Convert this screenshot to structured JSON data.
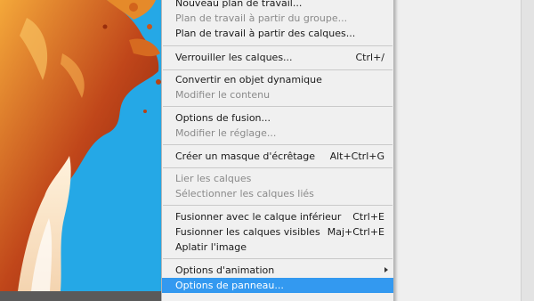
{
  "menu": {
    "items": [
      {
        "label": "Nouveau plan de travail...",
        "shortcut": "",
        "state": "enabled"
      },
      {
        "label": "Plan de travail à partir du groupe...",
        "shortcut": "",
        "state": "disabled"
      },
      {
        "label": "Plan de travail à partir des calques...",
        "shortcut": "",
        "state": "enabled"
      },
      {
        "label": "Verrouiller les calques...",
        "shortcut": "Ctrl+/",
        "state": "enabled"
      },
      {
        "label": "Convertir en objet dynamique",
        "shortcut": "",
        "state": "enabled"
      },
      {
        "label": "Modifier le contenu",
        "shortcut": "",
        "state": "disabled"
      },
      {
        "label": "Options de fusion...",
        "shortcut": "",
        "state": "enabled"
      },
      {
        "label": "Modifier le réglage...",
        "shortcut": "",
        "state": "disabled"
      },
      {
        "label": "Créer un masque d'écrêtage",
        "shortcut": "Alt+Ctrl+G",
        "state": "enabled"
      },
      {
        "label": "Lier les calques",
        "shortcut": "",
        "state": "disabled"
      },
      {
        "label": "Sélectionner les calques liés",
        "shortcut": "",
        "state": "disabled"
      },
      {
        "label": "Fusionner avec le calque inférieur",
        "shortcut": "Ctrl+E",
        "state": "enabled"
      },
      {
        "label": "Fusionner les calques visibles",
        "shortcut": "Maj+Ctrl+E",
        "state": "enabled"
      },
      {
        "label": "Aplatir l'image",
        "shortcut": "",
        "state": "enabled"
      },
      {
        "label": "Options d'animation",
        "shortcut": "",
        "state": "enabled",
        "submenu": true
      },
      {
        "label": "Options de panneau...",
        "shortcut": "",
        "state": "selected"
      }
    ]
  },
  "colors": {
    "canvas_background": "#25a8e6",
    "menu_background": "#f0f0f0",
    "selection": "#3399f0",
    "disabled_text": "#8a8a8a"
  }
}
